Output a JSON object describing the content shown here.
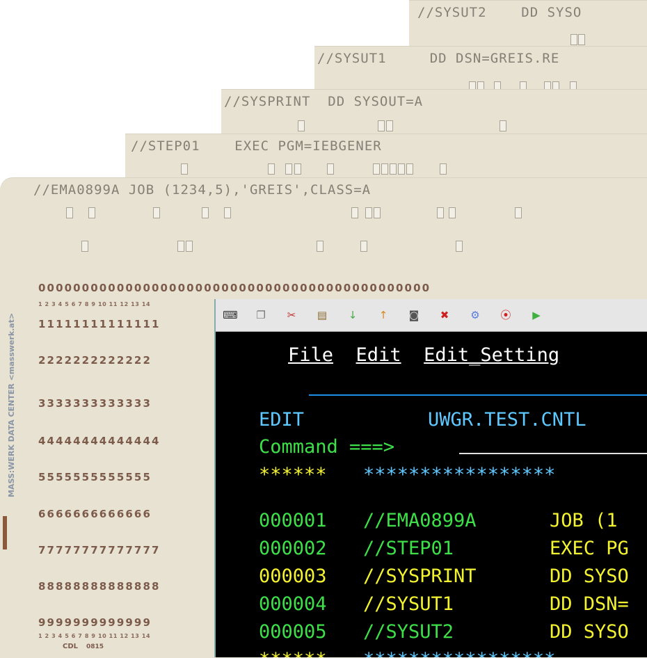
{
  "cards": [
    {
      "text": "//SYSUT2    DD SYSO"
    },
    {
      "text": "//SYSUT1     DD DSN=GREIS.RE"
    },
    {
      "text": "//SYSPRINT  DD SYSOUT=A"
    },
    {
      "text": "//STEP01    EXEC PGM=IEBGENER"
    },
    {
      "text": "//EMA0899A JOB (1234,5),'GREIS',CLASS=A"
    }
  ],
  "card_front": {
    "rows": [
      "000000000000000000000000000000000000000000000",
      "11111111111111",
      "2222222222222",
      "3333333333333",
      "44444444444444",
      "5555555555555",
      "6666666666666",
      "77777777777777",
      "88888888888888",
      "9999999999999"
    ],
    "column_numbers": "1 2 3 4 5 6 7 8 9 10 11 12 13 14",
    "sidebar_text": "MASS:WERK DATA CENTER <masswerk.at>",
    "brand": "CDL",
    "number": "0815"
  },
  "toolbar": {
    "icons": [
      "keyboard-icon",
      "copy-icon",
      "cut-icon",
      "paste-icon",
      "download-icon",
      "upload-icon",
      "camera-icon",
      "cancel-icon",
      "settings-icon",
      "record-icon",
      "play-icon"
    ]
  },
  "terminal": {
    "menu": {
      "file": "File",
      "edit": "Edit",
      "edit_settings": "Edit_Setting"
    },
    "header_mode": "EDIT",
    "header_dataset": "UWGR.TEST.CNTL",
    "command_label": "Command ===>",
    "top_marker": "******",
    "top_stars": "*****************",
    "lines": [
      {
        "num": "000001",
        "name": "//EMA0899A",
        "op": "JOB (1"
      },
      {
        "num": "000002",
        "name": "//STEP01",
        "op": "EXEC PG"
      },
      {
        "num": "000003",
        "name": "//SYSPRINT",
        "op": "DD SYSO"
      },
      {
        "num": "000004",
        "name": "//SYSUT1",
        "op": "DD DSN="
      },
      {
        "num": "000005",
        "name": "//SYSUT2",
        "op": "DD SYSO"
      }
    ],
    "bottom_marker": "******",
    "bottom_stars": "*****************"
  },
  "colors": {
    "card": "#e7e2d2",
    "terminal_bg": "#000000",
    "green": "#3ee04a",
    "yellow": "#f3f330",
    "cyan": "#5fc8ff",
    "rule_blue": "#1e8fe8"
  }
}
